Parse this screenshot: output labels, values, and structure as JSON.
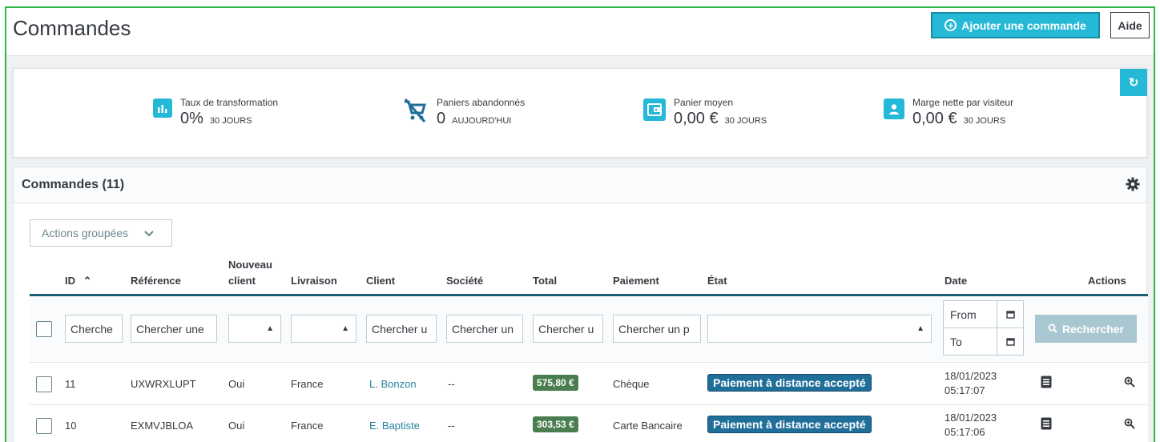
{
  "header": {
    "title": "Commandes",
    "add_order_label": "Ajouter une commande",
    "help_label": "Aide"
  },
  "kpis": [
    {
      "label": "Taux de transformation",
      "value": "0%",
      "period": "30 JOURS",
      "icon": "bar-chart-icon"
    },
    {
      "label": "Paniers abandonnés",
      "value": "0",
      "period": "AUJOURD'HUI",
      "icon": "cart-off-icon"
    },
    {
      "label": "Panier moyen",
      "value": "0,00 €",
      "period": "30 JOURS",
      "icon": "wallet-icon"
    },
    {
      "label": "Marge nette par visiteur",
      "value": "0,00 €",
      "period": "30 JOURS",
      "icon": "user-icon"
    }
  ],
  "orders": {
    "title": "Commandes (11)",
    "bulk_actions_label": "Actions groupées",
    "columns": {
      "id": "ID",
      "reference": "Référence",
      "new_client_1": "Nouveau",
      "new_client_2": "client",
      "delivery": "Livraison",
      "client": "Client",
      "company": "Société",
      "total": "Total",
      "payment": "Paiement",
      "state": "État",
      "date": "Date",
      "actions": "Actions"
    },
    "filters": {
      "id": "Cherche",
      "reference": "Chercher une",
      "client": "Chercher u",
      "company": "Chercher un",
      "total": "Chercher u",
      "payment": "Chercher un p",
      "date_from": "From",
      "date_to": "To",
      "search_button": "Rechercher"
    },
    "rows": [
      {
        "id": "11",
        "reference": "UXWRXLUPT",
        "new_client": "Oui",
        "delivery": "France",
        "client": "L. Bonzon",
        "company": "--",
        "total": "575,80 €",
        "payment": "Chèque",
        "state": "Paiement à distance accepté",
        "date": "18/01/2023",
        "time": "05:17:07"
      },
      {
        "id": "10",
        "reference": "EXMVJBLOA",
        "new_client": "Oui",
        "delivery": "France",
        "client": "E. Baptiste",
        "company": "--",
        "total": "303,53 €",
        "payment": "Carte Bancaire",
        "state": "Paiement à distance accepté",
        "date": "18/01/2023",
        "time": "05:17:06"
      }
    ]
  },
  "colors": {
    "accent": "#25b9d7",
    "frame_border": "#2db84a",
    "total_badge": "#4a7d4f",
    "state_badge": "#1f6f9a",
    "table_header_line": "#1f5d75"
  }
}
